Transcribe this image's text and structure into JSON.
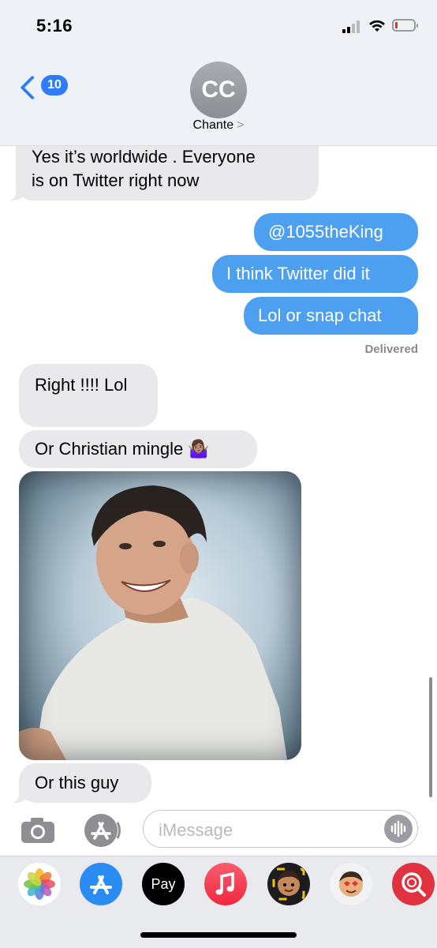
{
  "status_bar": {
    "time": "5:16"
  },
  "header": {
    "back_badge": "10",
    "avatar_initials": "CC",
    "contact_name": "Chante",
    "contact_chevron": ">"
  },
  "messages": [
    {
      "side": "in",
      "text_lines": [
        "Yes it’s worldwide . Everyone",
        "is on Twitter right now"
      ]
    },
    {
      "side": "out",
      "text": "@1055theKing"
    },
    {
      "side": "out",
      "text": "I think Twitter did it"
    },
    {
      "side": "out",
      "text": "Lol or snap chat"
    },
    {
      "side": "in",
      "text": "Right !!!! Lol"
    },
    {
      "side": "in",
      "text": "Or Christian mingle 🤷🏽‍♀️"
    },
    {
      "side": "in",
      "type": "image"
    },
    {
      "side": "in",
      "text": "Or this guy"
    }
  ],
  "delivered_label": "Delivered",
  "input": {
    "placeholder": "iMessage"
  },
  "app_drawer": {
    "apps": [
      "photos-app",
      "app-store-app",
      "apple-pay-app",
      "music-app",
      "memoji-app",
      "memoji-stickers-app",
      "search-images-app"
    ],
    "pay_label": "Pay",
    "apple_glyph": ""
  },
  "colors": {
    "outgoing_bubble": "#4d9ff0",
    "incoming_bubble": "#e9e9eb",
    "accent": "#2f7cf6"
  }
}
